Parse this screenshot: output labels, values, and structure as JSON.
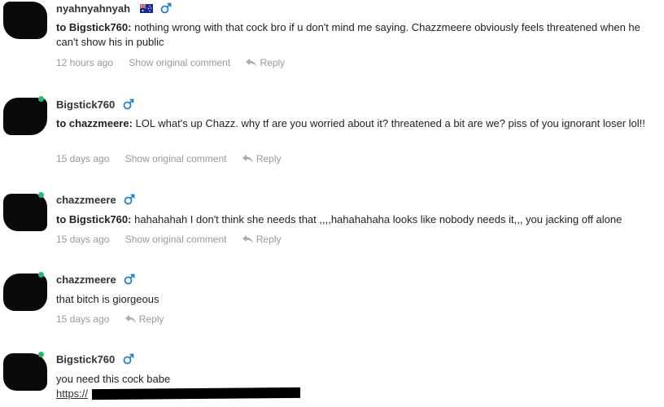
{
  "comments": [
    {
      "username": "nyahnyahnyah",
      "reply_to": "to Bigstick760:",
      "text": "nothing wrong with that cock bro if u don't mind me saying. Chazzmeere obviously feels threatened when he can't show his in public",
      "time": "12 hours ago",
      "show_original": "Show original comment",
      "reply": "Reply",
      "gender_icon": "male-icon",
      "flag_icon": "australia-flag-icon"
    },
    {
      "username": "Bigstick760",
      "reply_to": "to chazzmeere:",
      "text": "LOL what's up Chazz. why tf are you worried about it? threatened a bit are we? piss of you ignorant loser lol!!",
      "time": "15 days ago",
      "show_original": "Show original comment",
      "reply": "Reply",
      "gender_icon": "male-icon"
    },
    {
      "username": "chazzmeere",
      "reply_to": "to Bigstick760:",
      "text": "hahahahah I don't think she needs that ,,,,hahahahaha looks like nobody needs it,,, you jacking off alone",
      "time": "15 days ago",
      "show_original": "Show original comment",
      "reply": "Reply",
      "gender_icon": "male-icon"
    },
    {
      "username": "chazzmeere",
      "text": "that bitch is giorgeous",
      "time": "15 days ago",
      "reply": "Reply",
      "gender_icon": "male-icon"
    },
    {
      "username": "Bigstick760",
      "text": "you need this cock babe",
      "link_prefix": "https://",
      "gender_icon": "male-icon"
    }
  ],
  "colors": {
    "male_icon": "#2a7fc1",
    "meta_text": "#999999",
    "online_dot": "#2bb673"
  }
}
